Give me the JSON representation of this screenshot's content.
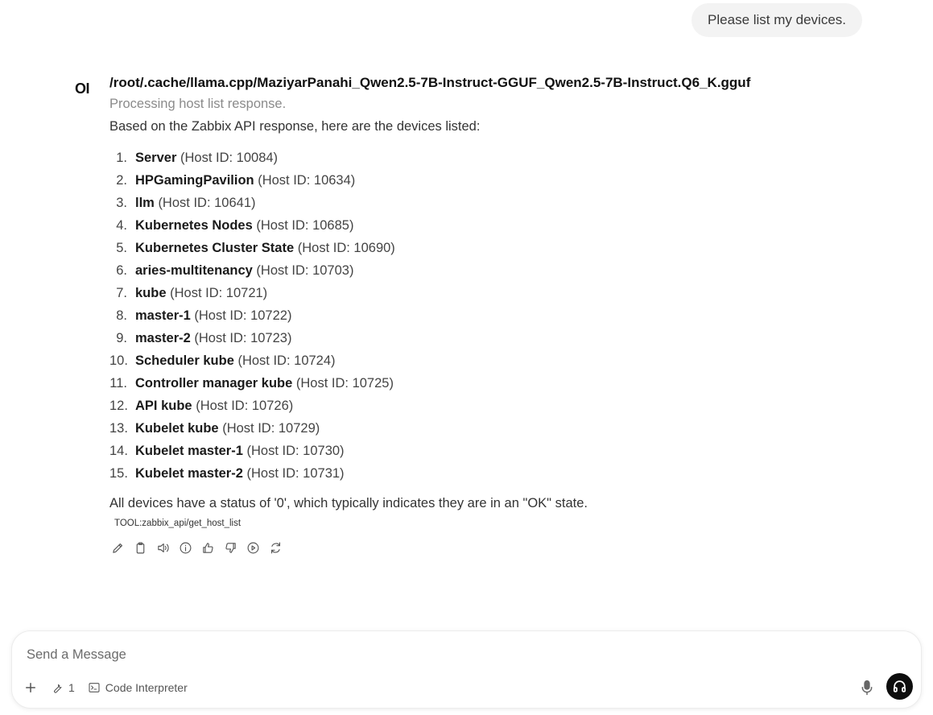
{
  "user_message": "Please list my devices.",
  "assistant": {
    "avatar_text": "OI",
    "model_name": "/root/.cache/llama.cpp/MaziyarPanahi_Qwen2.5-7B-Instruct-GGUF_Qwen2.5-7B-Instruct.Q6_K.gguf",
    "status": "Processing host list response.",
    "intro": "Based on the Zabbix API response, here are the devices listed:",
    "devices": [
      {
        "num": "1.",
        "name": "Server",
        "host_id": "(Host ID: 10084)"
      },
      {
        "num": "2.",
        "name": "HPGamingPavilion",
        "host_id": "(Host ID: 10634)"
      },
      {
        "num": "3.",
        "name": "llm",
        "host_id": "(Host ID: 10641)"
      },
      {
        "num": "4.",
        "name": "Kubernetes Nodes",
        "host_id": "(Host ID: 10685)"
      },
      {
        "num": "5.",
        "name": "Kubernetes Cluster State",
        "host_id": "(Host ID: 10690)"
      },
      {
        "num": "6.",
        "name": "aries-multitenancy",
        "host_id": "(Host ID: 10703)"
      },
      {
        "num": "7.",
        "name": "kube",
        "host_id": "(Host ID: 10721)"
      },
      {
        "num": "8.",
        "name": "master-1",
        "host_id": "(Host ID: 10722)"
      },
      {
        "num": "9.",
        "name": "master-2",
        "host_id": "(Host ID: 10723)"
      },
      {
        "num": "10.",
        "name": "Scheduler kube",
        "host_id": "(Host ID: 10724)"
      },
      {
        "num": "11.",
        "name": "Controller manager kube",
        "host_id": "(Host ID: 10725)"
      },
      {
        "num": "12.",
        "name": "API kube",
        "host_id": "(Host ID: 10726)"
      },
      {
        "num": "13.",
        "name": "Kubelet kube",
        "host_id": "(Host ID: 10729)"
      },
      {
        "num": "14.",
        "name": "Kubelet master-1",
        "host_id": "(Host ID: 10730)"
      },
      {
        "num": "15.",
        "name": "Kubelet master-2",
        "host_id": "(Host ID: 10731)"
      }
    ],
    "summary": "All devices have a status of '0', which typically indicates they are in an \"OK\" state.",
    "tool_tag": "TOOL:zabbix_api/get_host_list",
    "actions": [
      "edit-icon",
      "copy-icon",
      "read-aloud-icon",
      "info-icon",
      "thumbs-up-icon",
      "thumbs-down-icon",
      "continue-icon",
      "regenerate-icon"
    ]
  },
  "composer": {
    "placeholder": "Send a Message",
    "tools_count": "1",
    "code_interpreter_label": "Code Interpreter",
    "plus_icon": "plus-icon",
    "tools_icon": "wrench-icon",
    "code_icon": "terminal-icon",
    "mic_icon": "microphone-icon",
    "call_icon": "headphones-icon"
  }
}
